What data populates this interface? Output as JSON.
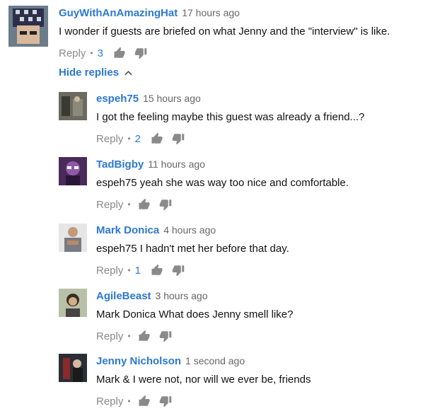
{
  "top_comment": {
    "author": "GuyWithAnAmazingHat",
    "time": "17 hours ago",
    "text": "I wonder if guests are briefed on what Jenny and the \"interview\" is like.",
    "reply_label": "Reply",
    "like_count": "3"
  },
  "hide_replies_label": "Hide replies",
  "replies": [
    {
      "author": "espeh75",
      "time": "15 hours ago",
      "text": "I got the feeling maybe this guest was already a friend...?",
      "reply_label": "Reply",
      "like_count": "2"
    },
    {
      "author": "TadBigby",
      "time": "11 hours ago",
      "text": "espeh75 yeah she was way too nice and comfortable.",
      "reply_label": "Reply",
      "like_count": ""
    },
    {
      "author": "Mark Donica",
      "time": "4 hours ago",
      "text": "espeh75 I hadn't met her before that day.",
      "reply_label": "Reply",
      "like_count": "1"
    },
    {
      "author": "AgileBeast",
      "time": "3 hours ago",
      "text": "Mark Donica What does Jenny smell like?",
      "reply_label": "Reply",
      "like_count": ""
    },
    {
      "author": "Jenny Nicholson",
      "time": "1 second ago",
      "text": "Mark & I were not, nor will we ever be, friends",
      "reply_label": "Reply",
      "like_count": ""
    }
  ],
  "icons": {
    "like": "thumbs-up-icon",
    "dislike": "thumbs-down-icon",
    "hide": "chevron-up-icon"
  },
  "colors": {
    "link": "#2b78d2",
    "meta": "#8a8a8a",
    "icon": "#8a8a8a"
  }
}
